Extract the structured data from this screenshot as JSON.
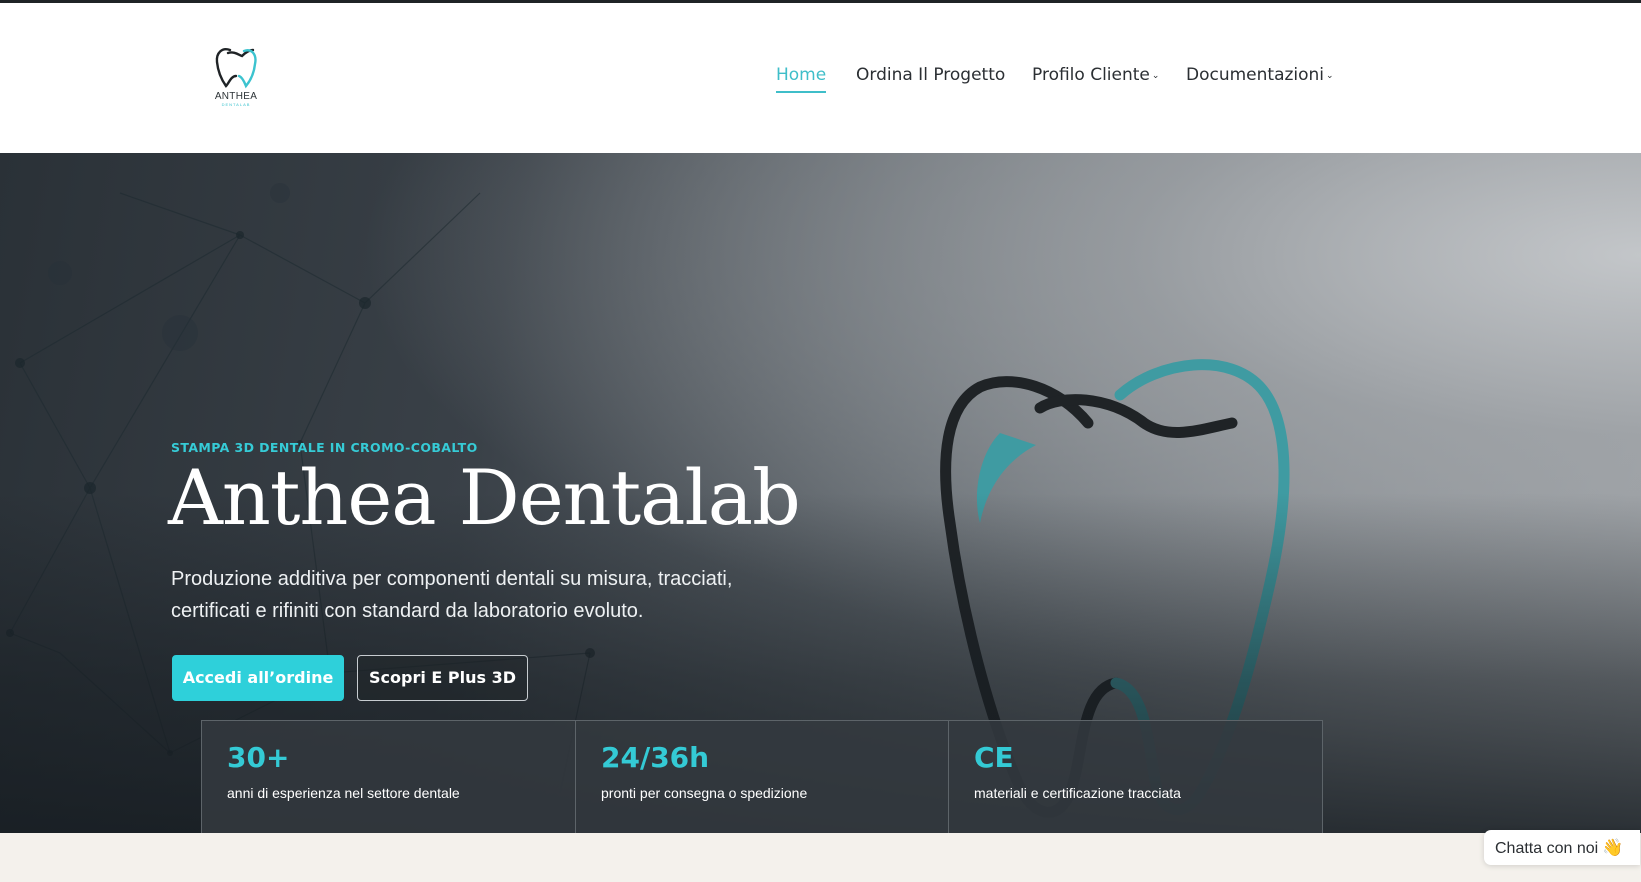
{
  "brand": {
    "logo_name": "ANTHEA",
    "logo_sub": "DENTALAB",
    "primary_color": "#2ed0da",
    "dark_color": "#1f2326"
  },
  "nav": {
    "items": [
      {
        "label": "Home",
        "active": true
      },
      {
        "label": "Ordina Il Progetto"
      },
      {
        "label": "Profilo Cliente",
        "has_dropdown": true
      },
      {
        "label": "Documentazioni",
        "has_dropdown": true
      }
    ],
    "dropdown_icon": "chevron-down-icon"
  },
  "hero": {
    "eyebrow": "STAMPA 3D DENTALE IN CROMO-COBALTO",
    "title": "Anthea Dentalab",
    "subtitle": "Produzione additiva per componenti dentali su misura, tracciati, certificati e rifiniti con standard da laboratorio evoluto.",
    "primary_button": "Accedi all’ordine",
    "secondary_button": "Scopri E Plus 3D",
    "decor_icon": "tooth-logo-icon"
  },
  "stats": [
    {
      "value": "30+",
      "label": "anni di esperienza nel settore dentale"
    },
    {
      "value": "24/36h",
      "label": "pronti per consegna o spedizione"
    },
    {
      "value": "CE",
      "label": "materiali e certificazione tracciata"
    }
  ],
  "chat": {
    "label": "Chatta con noi",
    "emoji": "👋"
  }
}
